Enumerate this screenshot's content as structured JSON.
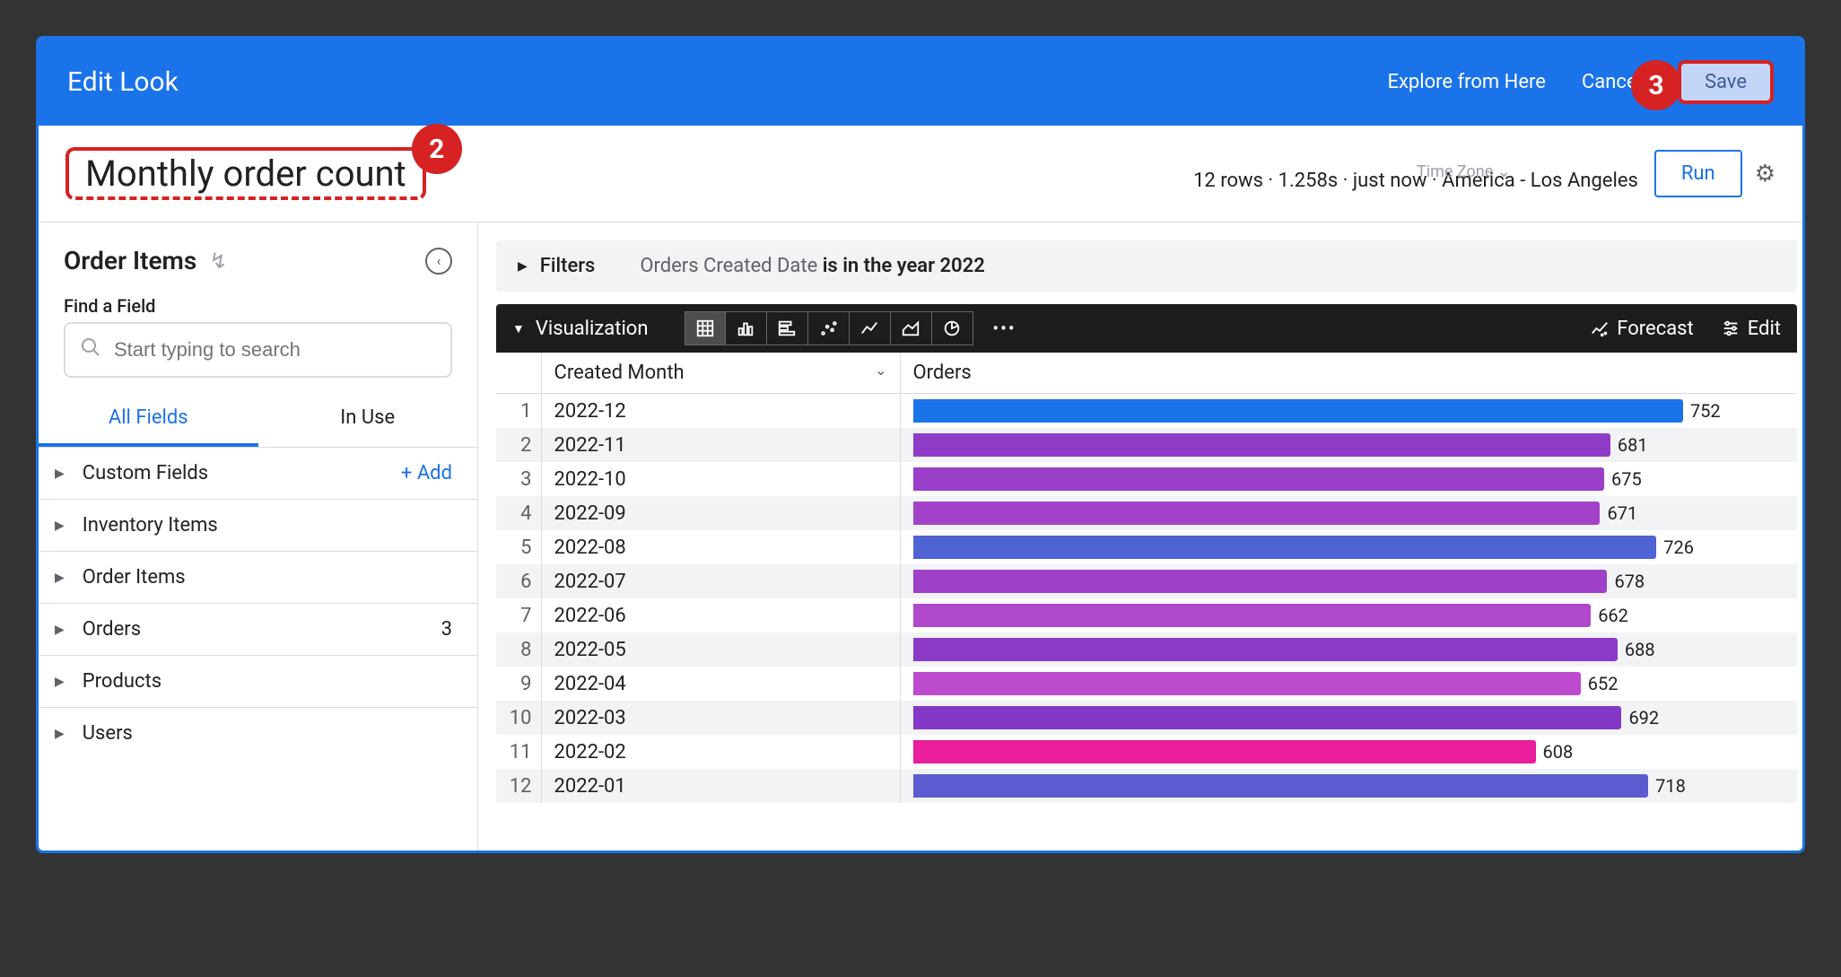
{
  "header": {
    "title": "Edit Look",
    "explore_link": "Explore from Here",
    "cancel_label": "Cancel",
    "save_label": "Save"
  },
  "callouts": {
    "title_marker": "2",
    "save_marker": "3"
  },
  "look": {
    "title": "Monthly order count",
    "status": "12 rows · 1.258s · just now · America - Los Angeles",
    "timezone_label": "Time Zone",
    "run_label": "Run"
  },
  "sidebar": {
    "explore_name": "Order Items",
    "find_label": "Find a Field",
    "search_placeholder": "Start typing to search",
    "tabs": {
      "all": "All Fields",
      "in_use": "In Use"
    },
    "add_label": "+  Add",
    "groups": [
      {
        "label": "Custom Fields",
        "extra": "add"
      },
      {
        "label": "Inventory Items"
      },
      {
        "label": "Order Items"
      },
      {
        "label": "Orders",
        "count": 3
      },
      {
        "label": "Products"
      },
      {
        "label": "Users"
      }
    ]
  },
  "filters": {
    "section_label": "Filters",
    "prefix": "Orders Created Date ",
    "bold": "is in the year 2022"
  },
  "viz": {
    "section_label": "Visualization",
    "forecast_label": "Forecast",
    "edit_label": "Edit"
  },
  "table": {
    "col_month": "Created Month",
    "col_orders": "Orders",
    "rows": [
      {
        "n": 1,
        "month": "2022-12",
        "orders": 752,
        "color": "#1a73e8"
      },
      {
        "n": 2,
        "month": "2022-11",
        "orders": 681,
        "color": "#8e3bc7"
      },
      {
        "n": 3,
        "month": "2022-10",
        "orders": 675,
        "color": "#9a3fc8"
      },
      {
        "n": 4,
        "month": "2022-09",
        "orders": 671,
        "color": "#a343c9"
      },
      {
        "n": 5,
        "month": "2022-08",
        "orders": 726,
        "color": "#4f63d2"
      },
      {
        "n": 6,
        "month": "2022-07",
        "orders": 678,
        "color": "#9e41c8"
      },
      {
        "n": 7,
        "month": "2022-06",
        "orders": 662,
        "color": "#b048cb"
      },
      {
        "n": 8,
        "month": "2022-05",
        "orders": 688,
        "color": "#8a3ac6"
      },
      {
        "n": 9,
        "month": "2022-04",
        "orders": 652,
        "color": "#bd4bcd"
      },
      {
        "n": 10,
        "month": "2022-03",
        "orders": 692,
        "color": "#8438c5"
      },
      {
        "n": 11,
        "month": "2022-02",
        "orders": 608,
        "color": "#e91e9b"
      },
      {
        "n": 12,
        "month": "2022-01",
        "orders": 718,
        "color": "#5a5cd0"
      }
    ]
  },
  "chart_data": {
    "type": "bar",
    "orientation": "horizontal",
    "title": "Monthly order count",
    "xlabel": "Orders",
    "ylabel": "Created Month",
    "categories": [
      "2022-12",
      "2022-11",
      "2022-10",
      "2022-09",
      "2022-08",
      "2022-07",
      "2022-06",
      "2022-05",
      "2022-04",
      "2022-03",
      "2022-02",
      "2022-01"
    ],
    "values": [
      752,
      681,
      675,
      671,
      726,
      678,
      662,
      688,
      652,
      692,
      608,
      718
    ],
    "xlim": [
      0,
      800
    ]
  }
}
